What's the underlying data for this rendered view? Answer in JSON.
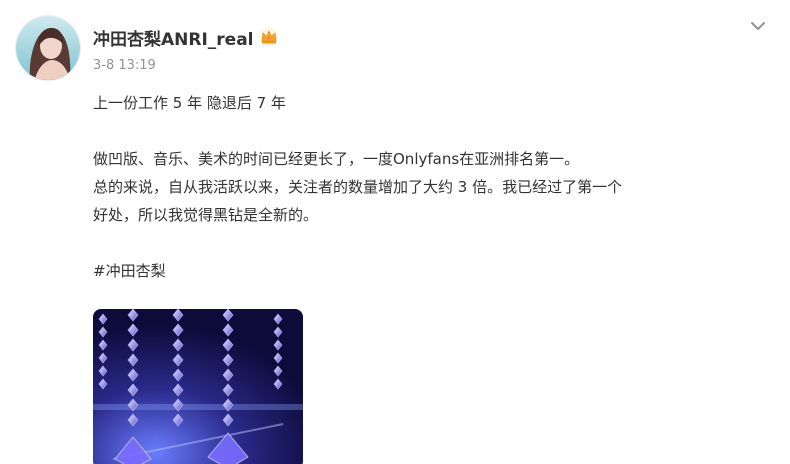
{
  "post": {
    "author": {
      "name": "冲田杏梨ANRI_real",
      "badge_icon": "crown-icon",
      "avatar_icon": "avatar-photo"
    },
    "time": "3-8 13:19",
    "menu_icon": "chevron-down-icon",
    "body": {
      "line1": "上一份工作 5 年 隐退后 7 年",
      "line2": "做凹版、音乐、美术的时间已经更长了，一度Onlyfans在亚洲排名第一。",
      "line3": "总的来说，自从我活跃以来，关注者的数量增加了大约 3 倍。我已经过了第一个",
      "line4": "好处，所以我觉得黑钻是全新的。",
      "hashtag": "#冲田杏梨"
    },
    "image_icon": "crystal-chandelier-photo"
  },
  "colors": {
    "text": "#333333",
    "muted": "#939393",
    "badge": "#F5A623"
  }
}
